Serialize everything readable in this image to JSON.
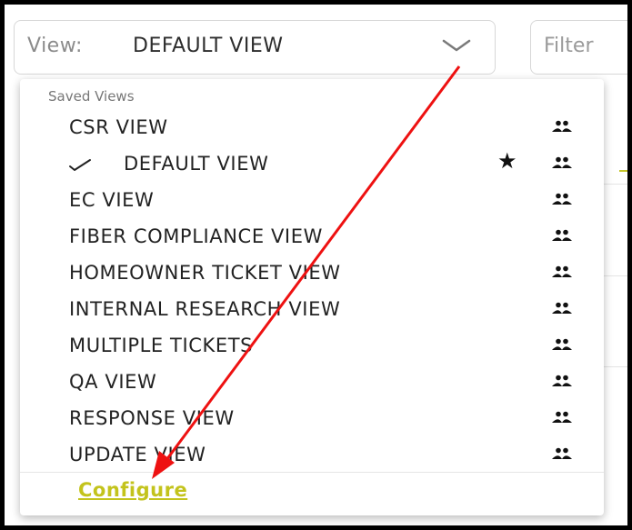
{
  "view_selector": {
    "prefix": "View:",
    "value": "DEFAULT VIEW",
    "chevron_icon": "chevron-down-icon"
  },
  "filter": {
    "placeholder": "Filter"
  },
  "dropdown": {
    "group_header": "Saved Views",
    "items": [
      {
        "label": "CSR VIEW",
        "selected": false,
        "default": false,
        "shared_icon": "people-icon"
      },
      {
        "label": "DEFAULT VIEW",
        "selected": true,
        "default": true,
        "shared_icon": "people-icon"
      },
      {
        "label": "EC VIEW",
        "selected": false,
        "default": false,
        "shared_icon": "people-icon"
      },
      {
        "label": "FIBER COMPLIANCE VIEW",
        "selected": false,
        "default": false,
        "shared_icon": "people-icon"
      },
      {
        "label": "HOMEOWNER TICKET VIEW",
        "selected": false,
        "default": false,
        "shared_icon": "people-icon"
      },
      {
        "label": "INTERNAL RESEARCH VIEW",
        "selected": false,
        "default": false,
        "shared_icon": "people-icon"
      },
      {
        "label": "MULTIPLE TICKETS",
        "selected": false,
        "default": false,
        "shared_icon": "people-icon"
      },
      {
        "label": "QA VIEW",
        "selected": false,
        "default": false,
        "shared_icon": "people-icon"
      },
      {
        "label": "RESPONSE VIEW",
        "selected": false,
        "default": false,
        "shared_icon": "people-icon"
      },
      {
        "label": "UPDATE VIEW",
        "selected": false,
        "default": false,
        "shared_icon": "people-icon"
      }
    ],
    "configure_label": "Configure"
  },
  "colors": {
    "link": "#c3c31c",
    "annotation_arrow": "#ee1111",
    "frame_border": "#000000"
  }
}
